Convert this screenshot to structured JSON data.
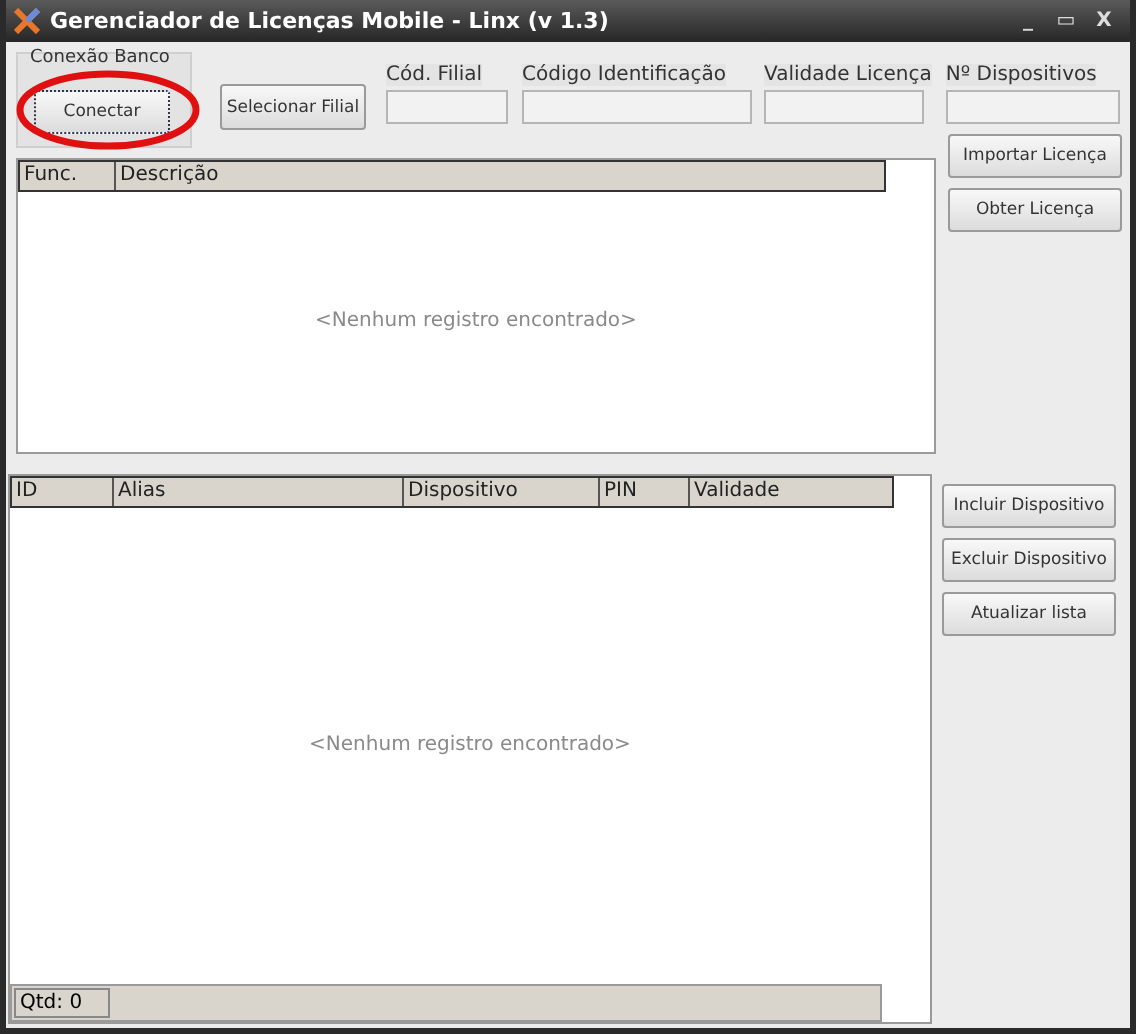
{
  "window": {
    "title": "Gerenciador de Licenças Mobile - Linx (v 1.3)",
    "controls": [
      "_",
      "▭",
      "X"
    ]
  },
  "connection_group": {
    "title": "Conexão Banco",
    "button": "Conectar",
    "highlighted": true
  },
  "select_branch_button": "Selecionar Filial",
  "fields": [
    {
      "label": "Cód. Filial"
    },
    {
      "label": "Código Identificação"
    },
    {
      "label": "Validade Licença"
    },
    {
      "label": "Nº Dispositivos"
    }
  ],
  "license_buttons": [
    "Importar Licença",
    "Obter Licença"
  ],
  "license_table": {
    "columns": [
      "Func.",
      "Descrição"
    ],
    "empty_message": "<Nenhum registro encontrado>"
  },
  "device_table": {
    "columns": [
      "ID",
      "Alias",
      "Dispositivo",
      "PIN",
      "Validade"
    ],
    "empty_message": "<Nenhum registro encontrado>"
  },
  "device_buttons": [
    "Incluir Dispositivo",
    "Excluir Dispositivo",
    "Atualizar lista"
  ],
  "status_bar": {
    "count": "Qtd: 0"
  }
}
